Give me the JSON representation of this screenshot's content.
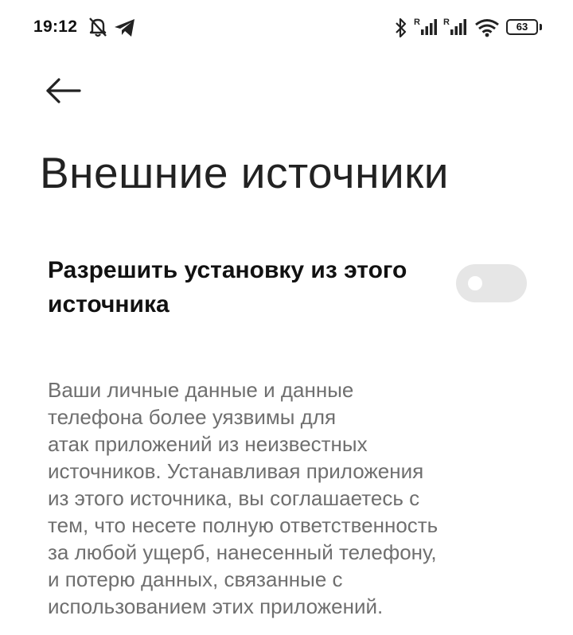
{
  "status_bar": {
    "time": "19:12",
    "battery": "63",
    "icons": [
      "muted-bell-icon",
      "telegram-icon",
      "bluetooth-icon",
      "signal-roaming-icon",
      "signal-roaming-icon",
      "wifi-icon",
      "battery-icon"
    ]
  },
  "header": {
    "back_icon": "arrow-left-icon",
    "title": "Внешние источники"
  },
  "setting": {
    "label": "Разрешить установку из этого источника",
    "enabled": false
  },
  "description": "Ваши личные данные и данные\nтелефона более уязвимы для\nатак приложений из неизвестных\nисточников. Устанавливая приложения\nиз этого источника, вы соглашаетесь с\nтем, что несете полную ответственность\nза любой ущерб, нанесенный телефону,\nи потерю данных, связанные с\nиспользованием этих приложений."
}
